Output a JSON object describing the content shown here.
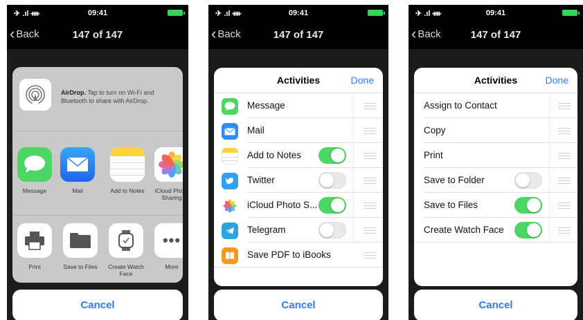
{
  "status": {
    "time": "09:41",
    "signal": "✈ .ıl ᚓ"
  },
  "nav": {
    "back_label": "Back",
    "title": "147 of 147"
  },
  "share_sheet": {
    "airdrop_title": "AirDrop.",
    "airdrop_text": "Tap to turn on Wi-Fi and Bluetooth to share with AirDrop.",
    "apps": [
      {
        "label": "Message",
        "icon": "message-icon",
        "color": "#4cd764"
      },
      {
        "label": "Mail",
        "icon": "mail-icon",
        "color": "#2f8cf6"
      },
      {
        "label": "Add to Notes",
        "icon": "notes-icon",
        "color": "#ffd43b"
      },
      {
        "label": "iCloud Photo Sharing",
        "icon": "photos-icon",
        "color": "#ffffff"
      }
    ],
    "actions": [
      {
        "label": "Print",
        "icon": "print-icon"
      },
      {
        "label": "Save to Files",
        "icon": "folder-icon"
      },
      {
        "label": "Create Watch Face",
        "icon": "watch-icon"
      },
      {
        "label": "More",
        "icon": "more-icon"
      }
    ],
    "cancel": "Cancel"
  },
  "activities_apps": {
    "title": "Activities",
    "done": "Done",
    "items": [
      {
        "label": "Message",
        "toggle": null
      },
      {
        "label": "Mail",
        "toggle": null
      },
      {
        "label": "Add to Notes",
        "toggle": true
      },
      {
        "label": "Twitter",
        "toggle": false
      },
      {
        "label": "iCloud Photo S...",
        "toggle": true
      },
      {
        "label": "Telegram",
        "toggle": false
      },
      {
        "label": "Save PDF to iBooks",
        "toggle": null
      }
    ],
    "cancel": "Cancel"
  },
  "activities_actions": {
    "title": "Activities",
    "done": "Done",
    "items": [
      {
        "label": "Assign to Contact",
        "toggle": null
      },
      {
        "label": "Copy",
        "toggle": null
      },
      {
        "label": "Print",
        "toggle": null
      },
      {
        "label": "Save to Folder",
        "toggle": false
      },
      {
        "label": "Save to Files",
        "toggle": true
      },
      {
        "label": "Create Watch Face",
        "toggle": true
      }
    ],
    "cancel": "Cancel"
  },
  "colors": {
    "accent": "#2f7bf6",
    "toggle_on": "#4cd764"
  }
}
